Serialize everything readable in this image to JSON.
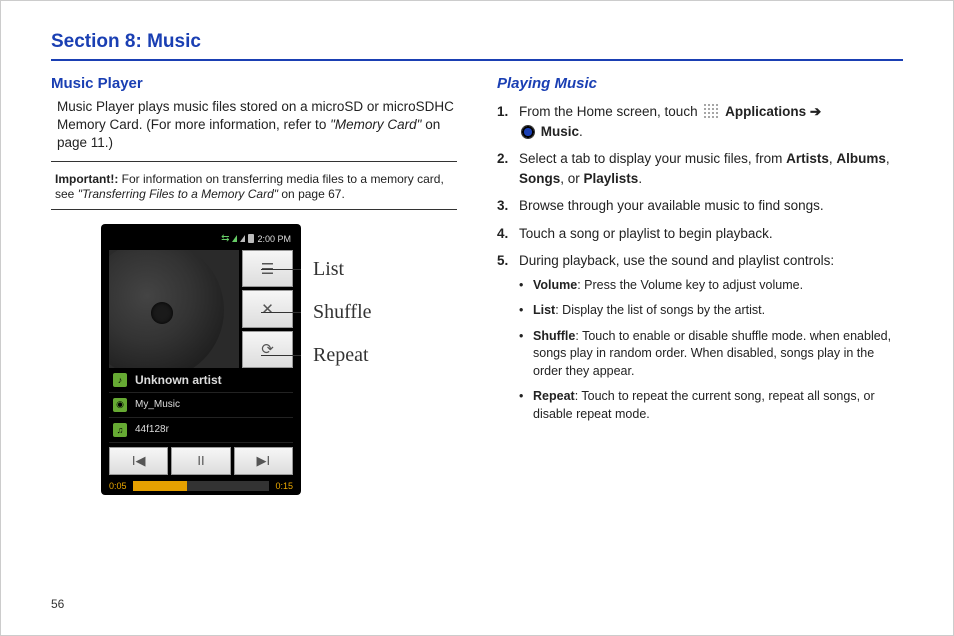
{
  "section_title": "Section 8: Music",
  "page_number": "56",
  "left": {
    "heading": "Music Player",
    "intro_a": "Music Player plays music files stored on a microSD or microSDHC Memory Card. (For more information, refer to ",
    "intro_ref": "\"Memory Card\"",
    "intro_b": " on page 11.)",
    "important_label": "Important!:",
    "important_text_a": " For information on transferring media files to a memory card, see ",
    "important_cite": "\"Transferring Files to a Memory Card\"",
    "important_text_b": " on page 67.",
    "labels": {
      "list": "List",
      "shuffle": "Shuffle",
      "repeat": "Repeat"
    },
    "phone": {
      "time": "2:00 PM",
      "artist_row": "Unknown artist",
      "album_row": "My_Music",
      "track_row": "44f128r",
      "elapsed": "0:05",
      "total": "0:15"
    }
  },
  "right": {
    "heading": "Playing Music",
    "step1_a": "From the Home screen, touch ",
    "step1_apps": "Applications",
    "step1_arrow": "➔",
    "step1_music": "Music",
    "step1_end": ".",
    "step2_a": "Select a tab to display your music files, from ",
    "step2_artists": "Artists",
    "step2_c1": ", ",
    "step2_albums": "Albums",
    "step2_c2": ", ",
    "step2_songs": "Songs",
    "step2_c3": ", or ",
    "step2_playlists": "Playlists",
    "step2_end": ".",
    "step3": "Browse through your available music to find songs.",
    "step4": "Touch a song or playlist to begin playback.",
    "step5": "During playback, use the sound and playlist controls:",
    "bullets": {
      "volume_l": "Volume",
      "volume_t": ": Press the Volume key to adjust volume.",
      "list_l": "List",
      "list_t": ": Display the list of songs by the artist.",
      "shuffle_l": "Shuffle",
      "shuffle_t": ": Touch to enable or disable shuffle mode. when enabled, songs play in random order. When disabled, songs play in the order they appear.",
      "repeat_l": "Repeat",
      "repeat_t": ": Touch to repeat the current song, repeat all songs, or disable repeat mode."
    }
  }
}
